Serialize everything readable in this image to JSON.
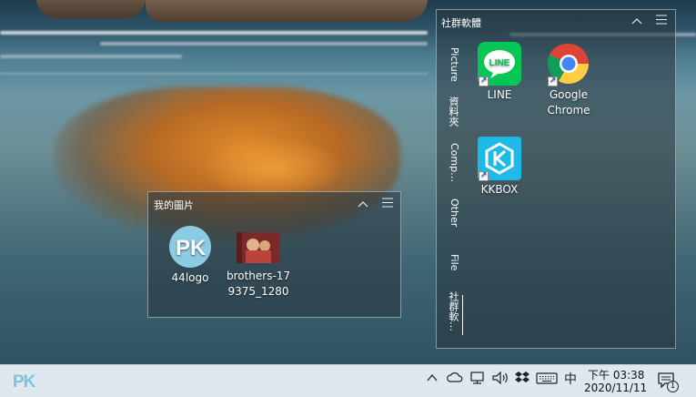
{
  "fence_pictures": {
    "title": "我的圖片",
    "collapse_icon": "chevron-up-icon",
    "menu_icon": "hamburger-menu-icon",
    "items": [
      {
        "label": "44logo",
        "icon": "pk-logo-image-icon"
      },
      {
        "label_line1": "brothers-17",
        "label_line2": "9375_1280",
        "icon": "photo-thumbnail-icon"
      }
    ]
  },
  "fence_social": {
    "title": "社群軟體",
    "collapse_icon": "chevron-up-icon",
    "menu_icon": "hamburger-menu-icon",
    "tabs": [
      "Picture",
      "資料夾",
      "Comp…",
      "Other",
      "File",
      "社群軟…"
    ],
    "active_tab": 5,
    "items": [
      {
        "label": "LINE",
        "icon": "line-app-icon",
        "color": "#06c755"
      },
      {
        "label_line1": "Google",
        "label_line2": "Chrome",
        "icon": "chrome-icon"
      },
      {
        "label": "KKBOX",
        "icon": "kkbox-icon",
        "color": "#1fb9e8"
      }
    ]
  },
  "taskbar": {
    "logo": "PK",
    "tray": {
      "chevron": "^",
      "ime": "中",
      "icons": [
        "chevron-up-icon",
        "onedrive-cloud-icon",
        "network-icon",
        "volume-icon",
        "dropbox-icon",
        "keyboard-icon"
      ]
    },
    "clock": {
      "time": "下午 03:38",
      "date": "2020/11/11"
    },
    "notification_count": "1"
  }
}
